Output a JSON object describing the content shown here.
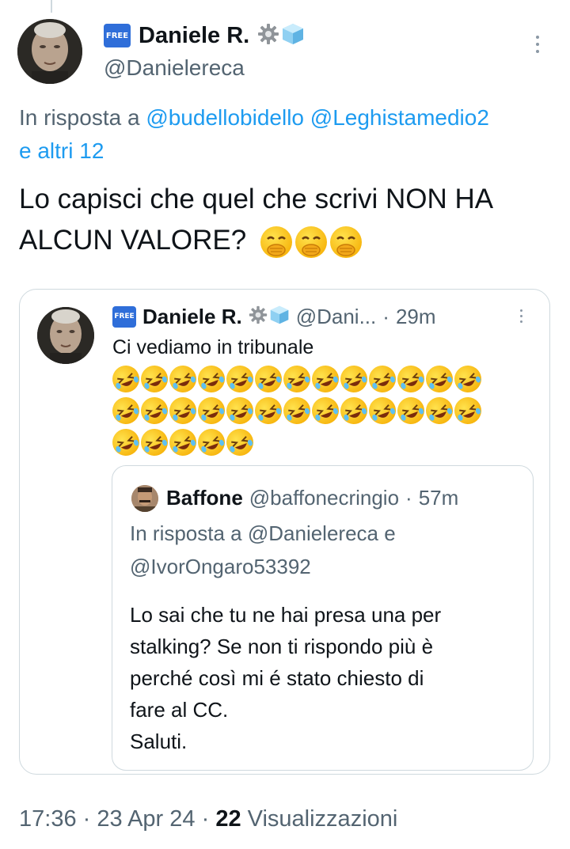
{
  "main_tweet": {
    "display_name": "Daniele R.",
    "handle": "@Danielereca",
    "reply_prefix": "In risposta a",
    "reply_mention_1": "@budellobidello",
    "reply_mention_2": "@Leghistamedio2",
    "reply_others": "e altri 12",
    "text": "Lo capisci che quel che scrivi NON HA ALCUN VALORE?",
    "text_emojis": [
      "hand-over-mouth",
      "hand-over-mouth",
      "hand-over-mouth"
    ],
    "time": "17:36",
    "date": "23 Apr 24",
    "views_count": "22",
    "views_label": "Visualizzazioni",
    "sep": "·"
  },
  "badge_label": "FREE",
  "quoted_tweet": {
    "display_name": "Daniele R.",
    "handle": "@Dani...",
    "age": "29m",
    "text": "Ci vediamo in tribunale",
    "emoji_rows": [
      13,
      13,
      5
    ],
    "emoji_name": "rolling-on-the-floor-laughing"
  },
  "nested_quote": {
    "display_name": "Baffone",
    "handle": "@baffonecringio",
    "age": "57m",
    "reply_line_1": "In risposta a @Danielereca e",
    "reply_line_2": "@IvorOngaro53392",
    "body_lines": [
      "Lo sai che tu ne hai presa una per",
      "stalking? Se non ti rispondo più è",
      "perché così mi é stato chiesto di",
      "fare al CC.",
      "Saluti."
    ]
  },
  "colors": {
    "link": "#1d9bf0",
    "muted": "#536471",
    "border": "#cfd9de",
    "badge": "#2f6ed9"
  },
  "icons": [
    "gear-icon",
    "ice-cube-icon",
    "more-options-icon"
  ]
}
